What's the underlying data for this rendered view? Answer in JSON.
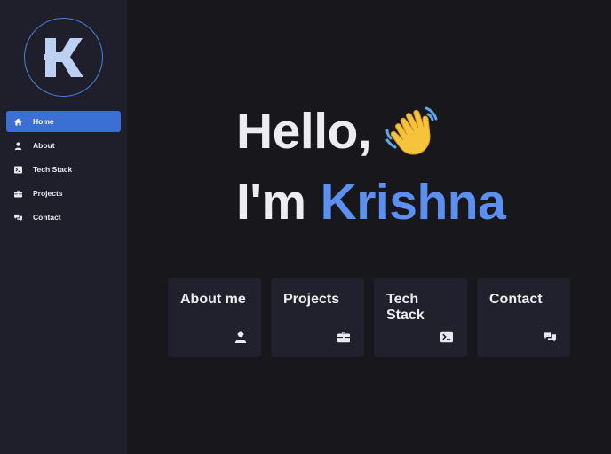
{
  "logo": {
    "letter": "K",
    "ring_color": "#4c7fd6",
    "icon": "k-logo-icon"
  },
  "sidebar": {
    "items": [
      {
        "label": "Home",
        "icon": "home-icon",
        "active": true
      },
      {
        "label": "About",
        "icon": "user-icon",
        "active": false
      },
      {
        "label": "Tech Stack",
        "icon": "terminal-icon",
        "active": false
      },
      {
        "label": "Projects",
        "icon": "briefcase-icon",
        "active": false
      },
      {
        "label": "Contact",
        "icon": "chat-icon",
        "active": false
      }
    ]
  },
  "hero": {
    "greeting": "Hello,",
    "emoji": "waving-hand-icon",
    "intro": "I'm",
    "name": "Krishna",
    "accent_color": "#5b8ff0"
  },
  "cards": [
    {
      "title": "About me",
      "icon": "user-icon"
    },
    {
      "title": "Projects",
      "icon": "briefcase-icon"
    },
    {
      "title": "Tech Stack",
      "icon": "terminal-icon"
    },
    {
      "title": "Contact",
      "icon": "chat-icon"
    }
  ],
  "colors": {
    "background": "#17171c",
    "sidebar": "#1f1f2c",
    "card": "#21212e",
    "active": "#3b6fd4"
  }
}
